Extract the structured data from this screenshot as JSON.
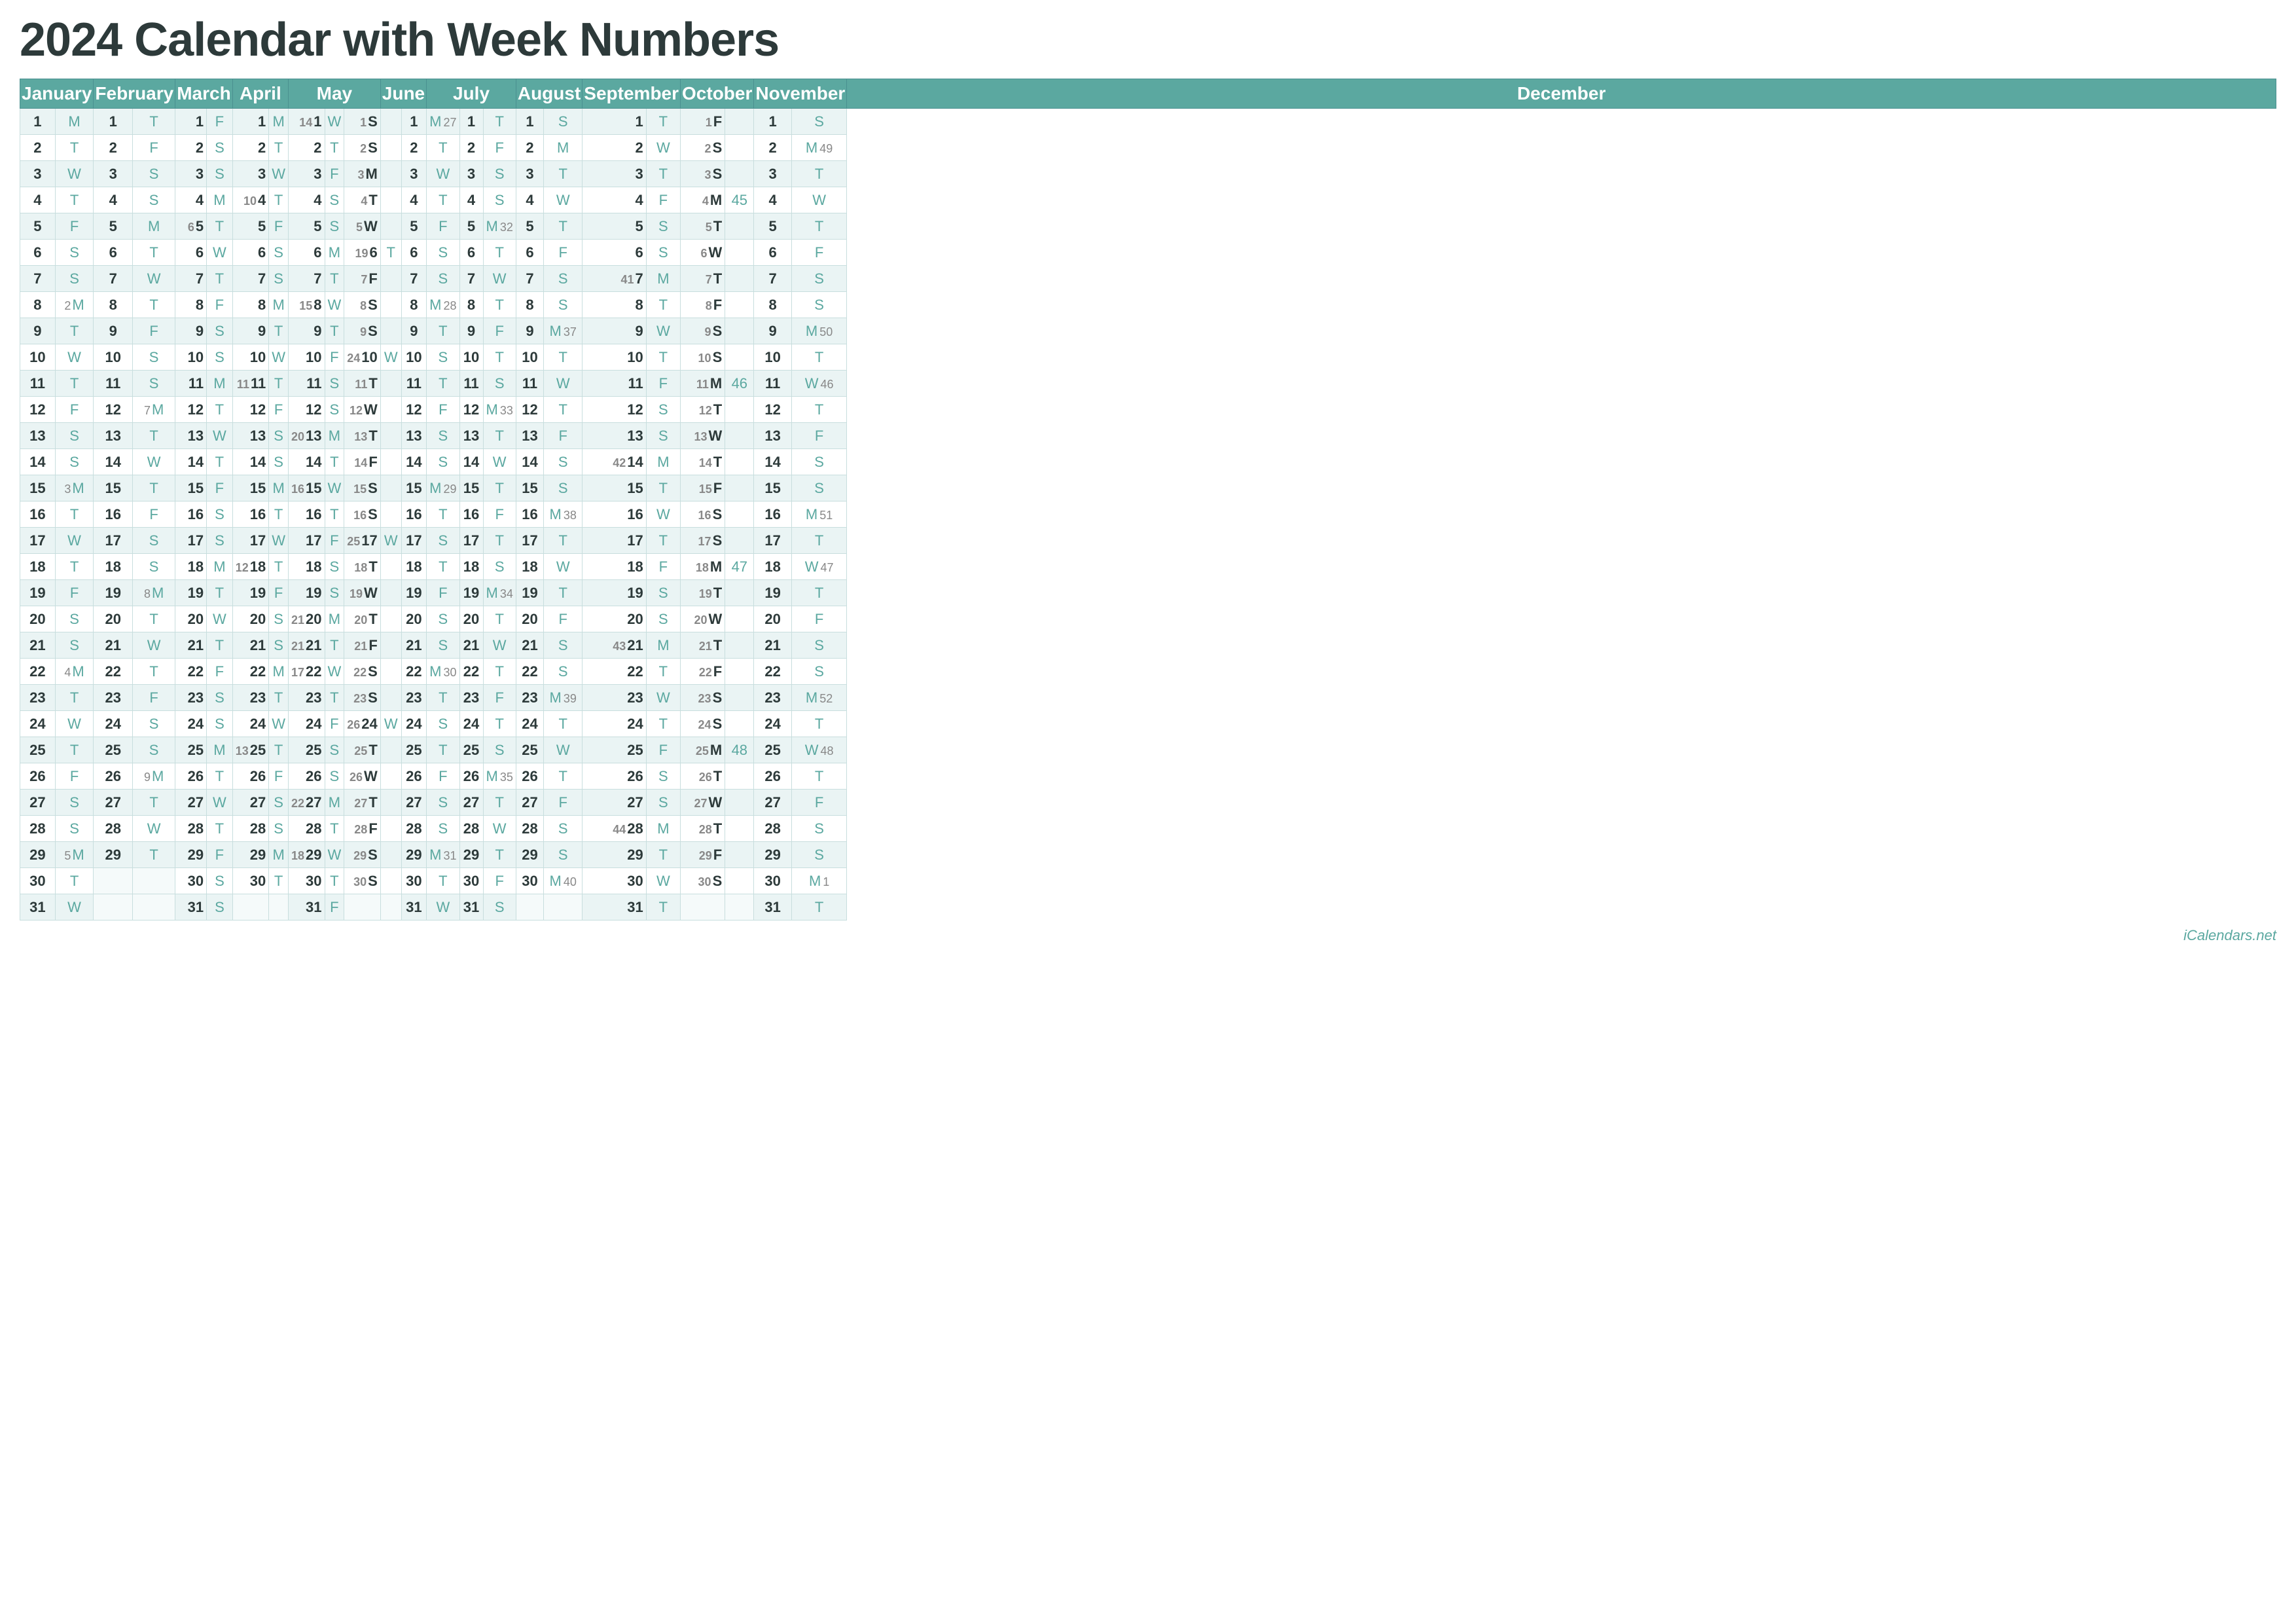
{
  "title": "2024 Calendar with Week Numbers",
  "footer": "iCalendars.net",
  "months": [
    "January",
    "February",
    "March",
    "April",
    "May",
    "June",
    "July",
    "August",
    "September",
    "October",
    "November",
    "December"
  ],
  "rows": [
    {
      "wk_left": "",
      "days": [
        {
          "m": 0,
          "d": 1,
          "day": "M"
        },
        {
          "m": 0,
          "wk": ""
        },
        {
          "m": 1,
          "d": 1,
          "day": "T"
        },
        {
          "m": 1,
          "wk": ""
        },
        {
          "m": 2,
          "d": 1,
          "day": "F"
        },
        {
          "m": 2,
          "wk": ""
        },
        {
          "m": 3,
          "d": 1,
          "day": "M"
        },
        {
          "m": 3,
          "wk": ""
        },
        {
          "m": 4,
          "d": 14,
          "wk_l": "14"
        },
        {
          "m": 4,
          "d2": 1,
          "day": "W"
        },
        {
          "m": 4,
          "wk": ""
        },
        {
          "m": 5,
          "d": 1,
          "day": "S"
        },
        {
          "m": 5,
          "wk": ""
        },
        {
          "m": 6,
          "d": 1,
          "day": "M"
        },
        {
          "m": 6,
          "wk": "27"
        },
        {
          "m": 7,
          "d": 1,
          "day": "T"
        },
        {
          "m": 7,
          "wk": ""
        },
        {
          "m": 8,
          "d": 1,
          "day": "S"
        },
        {
          "m": 8,
          "wk": ""
        },
        {
          "m": 9,
          "d": 1,
          "day": "T"
        },
        {
          "m": 9,
          "wk": ""
        },
        {
          "m": 10,
          "d": 1,
          "day": "F"
        },
        {
          "m": 10,
          "wk": ""
        },
        {
          "m": 11,
          "d": 1,
          "day": "S"
        },
        {
          "m": 11,
          "wk": ""
        }
      ]
    }
  ],
  "calendar_data": {
    "jan": [
      [
        1,
        "M",
        "",
        2,
        "T",
        "",
        3,
        "W",
        "",
        4,
        "T",
        "",
        5,
        "F",
        "",
        6,
        "S",
        "",
        7,
        "S",
        ""
      ],
      [
        8,
        "M",
        2,
        9,
        "T",
        "",
        10,
        "W",
        "",
        11,
        "T",
        "",
        12,
        "F",
        "",
        13,
        "S",
        "",
        14,
        "S",
        ""
      ],
      [
        15,
        "M",
        3,
        16,
        "T",
        "",
        17,
        "W",
        "",
        18,
        "T",
        "",
        19,
        "F",
        "",
        20,
        "S",
        "",
        21,
        "S",
        ""
      ],
      [
        22,
        "M",
        4,
        23,
        "T",
        "",
        24,
        "W",
        "",
        25,
        "T",
        "",
        26,
        "F",
        "",
        27,
        "S",
        "",
        28,
        "S",
        ""
      ],
      [
        29,
        "M",
        5,
        30,
        "T",
        "",
        31,
        "W",
        "",
        "",
        "",
        "",
        "",
        "",
        "",
        "",
        "",
        "",
        "",
        ""
      ]
    ]
  }
}
